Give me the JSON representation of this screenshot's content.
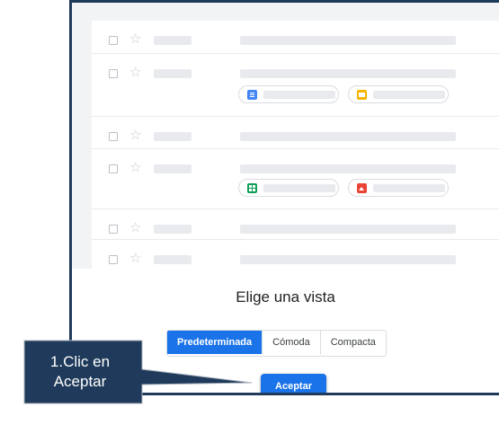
{
  "dialog": {
    "title": "Elige una vista",
    "options": [
      "Predeterminada",
      "Cómoda",
      "Compacta"
    ],
    "selected_option": "Predeterminada",
    "ok_label": "Aceptar"
  },
  "callout": {
    "line1": "1.Clic en",
    "line2": "Aceptar"
  },
  "preview": {
    "rows": [
      {
        "attachments": []
      },
      {
        "attachments": [
          "docs-icon",
          "slides-icon"
        ]
      },
      {
        "attachments": []
      },
      {
        "attachments": [
          "sheets-icon",
          "photo-icon"
        ]
      },
      {
        "attachments": []
      },
      {
        "attachments": []
      }
    ]
  },
  "colors": {
    "accent": "#1a73e8",
    "callout": "#1f3a5a",
    "docs": "#4285f4",
    "slides": "#f4b400",
    "sheets": "#0f9d58",
    "photo": "#ea4335"
  }
}
